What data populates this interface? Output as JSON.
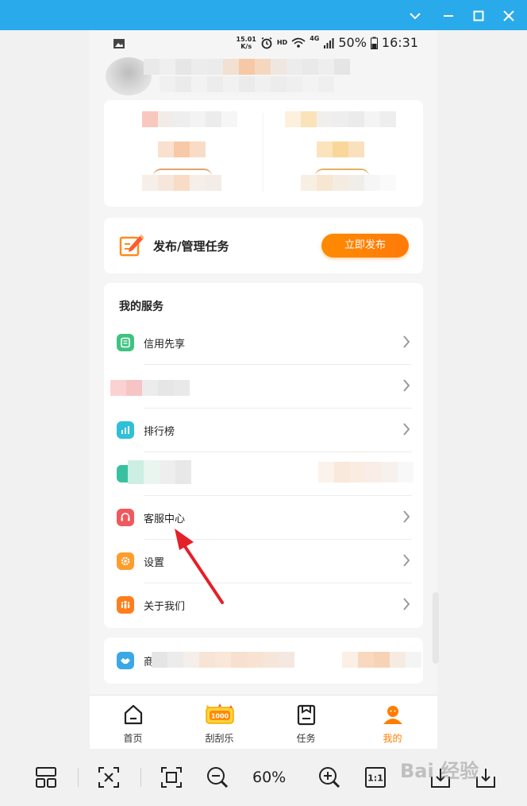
{
  "window": {
    "controls": [
      "chevron-down",
      "minimize",
      "maximize",
      "close"
    ]
  },
  "status_bar": {
    "net_speed_value": "15.01",
    "net_speed_unit": "K/s",
    "hd": "HD",
    "network": "4G",
    "battery": "50%",
    "time": "16:31"
  },
  "publish": {
    "label": "发布/管理任务",
    "button": "立即发布"
  },
  "services": {
    "title": "我的服务",
    "items": [
      {
        "label": "信用先享",
        "icon": "credit-icon",
        "color": "#3fc381"
      },
      {
        "label": "",
        "icon": "blurred-icon",
        "color": "#f7b0b0"
      },
      {
        "label": "排行榜",
        "icon": "ranking-chart-icon",
        "color": "#2ec0d8"
      },
      {
        "label": "",
        "icon": "blurred-icon",
        "color": "#38c1a0"
      },
      {
        "label": "客服中心",
        "icon": "headset-icon",
        "color": "#f0585d"
      },
      {
        "label": "设置",
        "icon": "settings-icon",
        "color": "#ff9d2b"
      },
      {
        "label": "关于我们",
        "icon": "people-icon",
        "color": "#ff7e1c"
      }
    ]
  },
  "business": {
    "label_partial": "商"
  },
  "tabs": [
    {
      "label": "首页",
      "icon": "home-icon",
      "active": false
    },
    {
      "label": "刮刮乐",
      "icon": "scratch-card-icon",
      "badge": "1000",
      "active": false
    },
    {
      "label": "任务",
      "icon": "task-icon",
      "active": false
    },
    {
      "label": "我的",
      "icon": "profile-icon",
      "active": true
    }
  ],
  "toolbar": {
    "zoom": "60%",
    "actual_size": "1:1",
    "tools": [
      "layout-icon",
      "screenshot-icon",
      "fit-screen-icon",
      "zoom-out-icon",
      "zoom-in-icon",
      "actual-size-icon",
      "download-icon",
      "download-icon"
    ]
  },
  "watermark": {
    "text": "Bai 经验"
  },
  "colors": {
    "accent": "#ff7d00",
    "titlebar": "#29aaea"
  }
}
